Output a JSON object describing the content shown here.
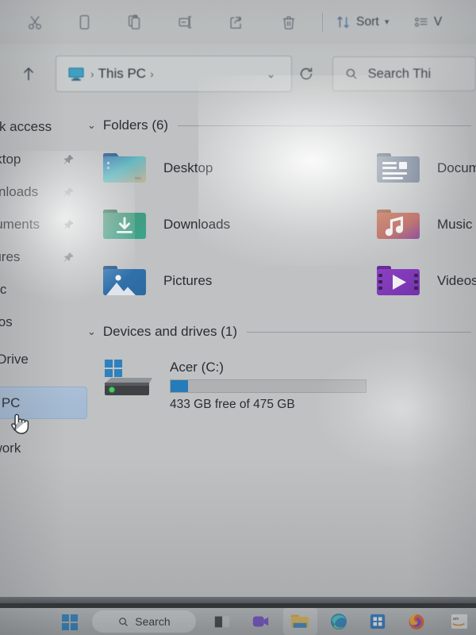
{
  "window": {
    "app": "File Explorer",
    "title": "This PC"
  },
  "toolbar": {
    "items": [
      {
        "name": "cut",
        "icon": "scissors-icon",
        "label": ""
      },
      {
        "name": "copy",
        "icon": "copy-icon",
        "label": ""
      },
      {
        "name": "paste",
        "icon": "paste-icon",
        "label": ""
      },
      {
        "name": "rename",
        "icon": "rename-icon",
        "label": ""
      },
      {
        "name": "share",
        "icon": "share-icon",
        "label": ""
      },
      {
        "name": "delete",
        "icon": "trash-icon",
        "label": ""
      }
    ],
    "sort_label": "Sort",
    "view_label": "View"
  },
  "address": {
    "up_tooltip": "Up",
    "pc_icon": "monitor-icon",
    "breadcrumb": "This PC",
    "separator": "›",
    "chevron": "∨",
    "refresh_icon": "refresh-icon"
  },
  "search": {
    "icon": "search-icon",
    "placeholder": "Search Thi"
  },
  "sidebar": {
    "items": [
      {
        "label": "Quick access",
        "pinned": false,
        "selected": false,
        "icon": "star-icon"
      },
      {
        "label": "Desktop",
        "pinned": true,
        "selected": false,
        "icon": "desktop-icon"
      },
      {
        "label": "Downloads",
        "pinned": true,
        "selected": false,
        "icon": "downloads-icon"
      },
      {
        "label": "Documents",
        "pinned": true,
        "selected": false,
        "icon": "documents-icon"
      },
      {
        "label": "Pictures",
        "pinned": true,
        "selected": false,
        "icon": "pictures-icon"
      },
      {
        "label": "Music",
        "pinned": false,
        "selected": false,
        "icon": "music-icon"
      },
      {
        "label": "Videos",
        "pinned": false,
        "selected": false,
        "icon": "videos-icon"
      },
      {
        "label": "OneDrive",
        "pinned": false,
        "selected": false,
        "icon": "onedrive-icon"
      },
      {
        "label": "This PC",
        "pinned": false,
        "selected": true,
        "icon": "thispc-icon"
      },
      {
        "label": "Network",
        "pinned": false,
        "selected": false,
        "icon": "network-icon"
      }
    ]
  },
  "main": {
    "folders_section": {
      "title": "Folders (6)",
      "chevron": "∨",
      "items": [
        {
          "label": "Desktop",
          "icon": "desktop-folder-icon"
        },
        {
          "label": "Documen",
          "icon": "documents-folder-icon"
        },
        {
          "label": "Downloads",
          "icon": "downloads-folder-icon"
        },
        {
          "label": "Music",
          "icon": "music-folder-icon"
        },
        {
          "label": "Pictures",
          "icon": "pictures-folder-icon"
        },
        {
          "label": "Videos",
          "icon": "videos-folder-icon"
        }
      ]
    },
    "devices_section": {
      "title": "Devices and drives (1)",
      "chevron": "∨",
      "drive": {
        "name": "Acer (C:)",
        "icon": "hard-drive-icon",
        "free_text": "433 GB free of 475 GB",
        "free_gb": 433,
        "total_gb": 475,
        "used_percent": 9,
        "bar_color": "#1076bd"
      }
    }
  },
  "taskbar": {
    "start_label": "Start",
    "search_label": "Search",
    "search_icon": "search-icon",
    "apps": [
      {
        "name": "task-view",
        "label": "Task View"
      },
      {
        "name": "teams",
        "label": "Microsoft Teams"
      },
      {
        "name": "file-explorer",
        "label": "File Explorer",
        "active": true
      },
      {
        "name": "edge",
        "label": "Microsoft Edge"
      },
      {
        "name": "microsoft-store",
        "label": "Microsoft Store"
      },
      {
        "name": "firefox",
        "label": "Firefox"
      },
      {
        "name": "amazon",
        "label": "Amazon"
      }
    ]
  },
  "colors": {
    "accent": "#1076bd",
    "selection": "#a6c0dd",
    "window_bg": "#c8c9c9"
  }
}
